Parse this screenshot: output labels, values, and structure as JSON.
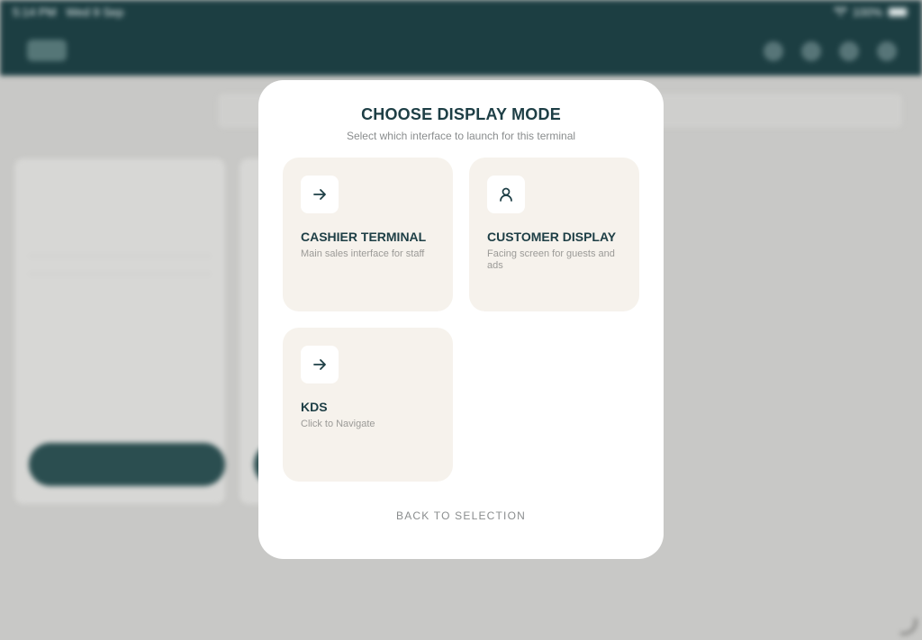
{
  "status_bar": {
    "time": "5:14 PM",
    "date": "Wed 9 Sep",
    "battery": "100%"
  },
  "modal": {
    "title": "CHOOSE DISPLAY MODE",
    "subtitle": "Select which interface to launch for this terminal",
    "options": [
      {
        "title": "CASHIER TERMINAL",
        "description": "Main sales interface for staff",
        "icon": "arrow-right-icon"
      },
      {
        "title": "CUSTOMER DISPLAY",
        "description": "Facing screen for guests and ads",
        "icon": "user-icon"
      },
      {
        "title": "KDS",
        "description": "Click to Navigate",
        "icon": "arrow-right-icon"
      }
    ],
    "back_label": "BACK TO SELECTION"
  },
  "colors": {
    "header": "#1c3e42",
    "accent_text": "#1d3e45",
    "option_bg": "#f6f2ec",
    "overlay": "#c8c8c6"
  }
}
